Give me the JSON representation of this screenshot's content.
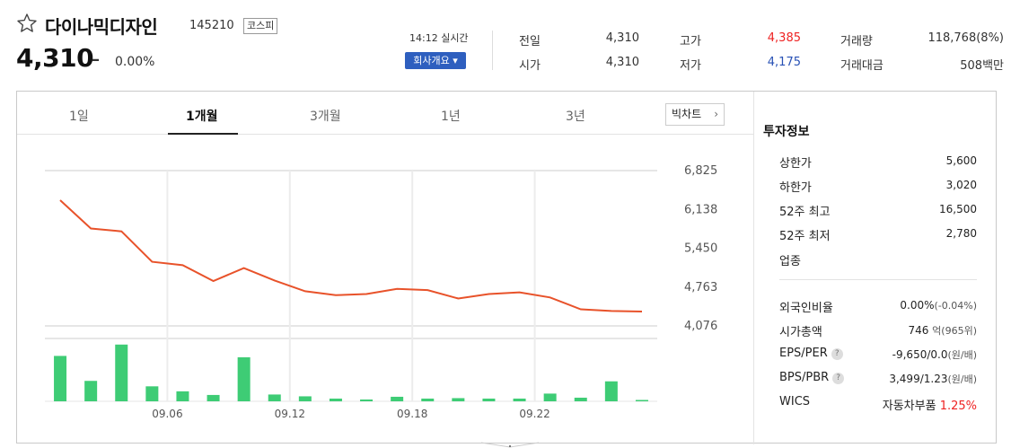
{
  "header": {
    "name": "다이나믹디자인",
    "code": "145210",
    "market": "코스피",
    "price": "4,310",
    "change_symbol": "–",
    "change_rate": "0.00%",
    "realtime": "14:12 실시간",
    "company_button": "회사개요 ▾"
  },
  "quote": {
    "prev_close_label": "전일",
    "prev_close": "4,310",
    "open_label": "시가",
    "open": "4,310",
    "high_label": "고가",
    "high": "4,385",
    "low_label": "저가",
    "low": "4,175",
    "volume_label": "거래량",
    "volume": "118,768(8%)",
    "amount_label": "거래대금",
    "amount": "508백만"
  },
  "tabs": {
    "day1": "1일",
    "month1": "1개월",
    "month3": "3개월",
    "year1": "1년",
    "year3": "3년",
    "bigchart": "빅차트"
  },
  "info": {
    "title": "투자정보",
    "upper_label": "상한가",
    "upper": "5,600",
    "lower_label": "하한가",
    "lower": "3,020",
    "w52_high_label": "52주 최고",
    "w52_high": "16,500",
    "w52_low_label": "52주 최저",
    "w52_low": "2,780",
    "industry_label": "업종",
    "foreign_label": "외국인비율",
    "foreign": "0.00%",
    "foreign_sub": "(-0.04%)",
    "mcap_label": "시가총액",
    "mcap": "746",
    "mcap_sub": "억(965위)",
    "eps_label": "EPS/PER",
    "eps": "-9,650/0.0",
    "eps_sub": "(원/배)",
    "bps_label": "BPS/PBR",
    "bps": "3,499/1.23",
    "bps_sub": "(원/배)",
    "wics_label": "WICS",
    "wics": "자동차부품",
    "wics_pct": "1.25%"
  },
  "colors": {
    "line": "#e8522a",
    "volume": "#3ecc75",
    "up": "#e22222",
    "down": "#2851b5"
  },
  "chart_data": {
    "type": "line",
    "x_ticks": [
      "09.06",
      "09.12",
      "09.18",
      "09.22"
    ],
    "y_ticks": [
      "6,825",
      "6,138",
      "5,450",
      "4,763",
      "4,076"
    ],
    "ylim": [
      4076,
      6825
    ],
    "price": [
      6300,
      5800,
      5750,
      5210,
      5150,
      4870,
      5100,
      4880,
      4690,
      4620,
      4640,
      4730,
      4710,
      4560,
      4640,
      4670,
      4580,
      4370,
      4340,
      4330
    ],
    "volume": [
      100,
      45,
      125,
      33,
      22,
      14,
      97,
      15,
      11,
      6,
      4,
      10,
      6,
      7,
      6,
      6,
      17,
      8,
      44,
      3
    ]
  }
}
